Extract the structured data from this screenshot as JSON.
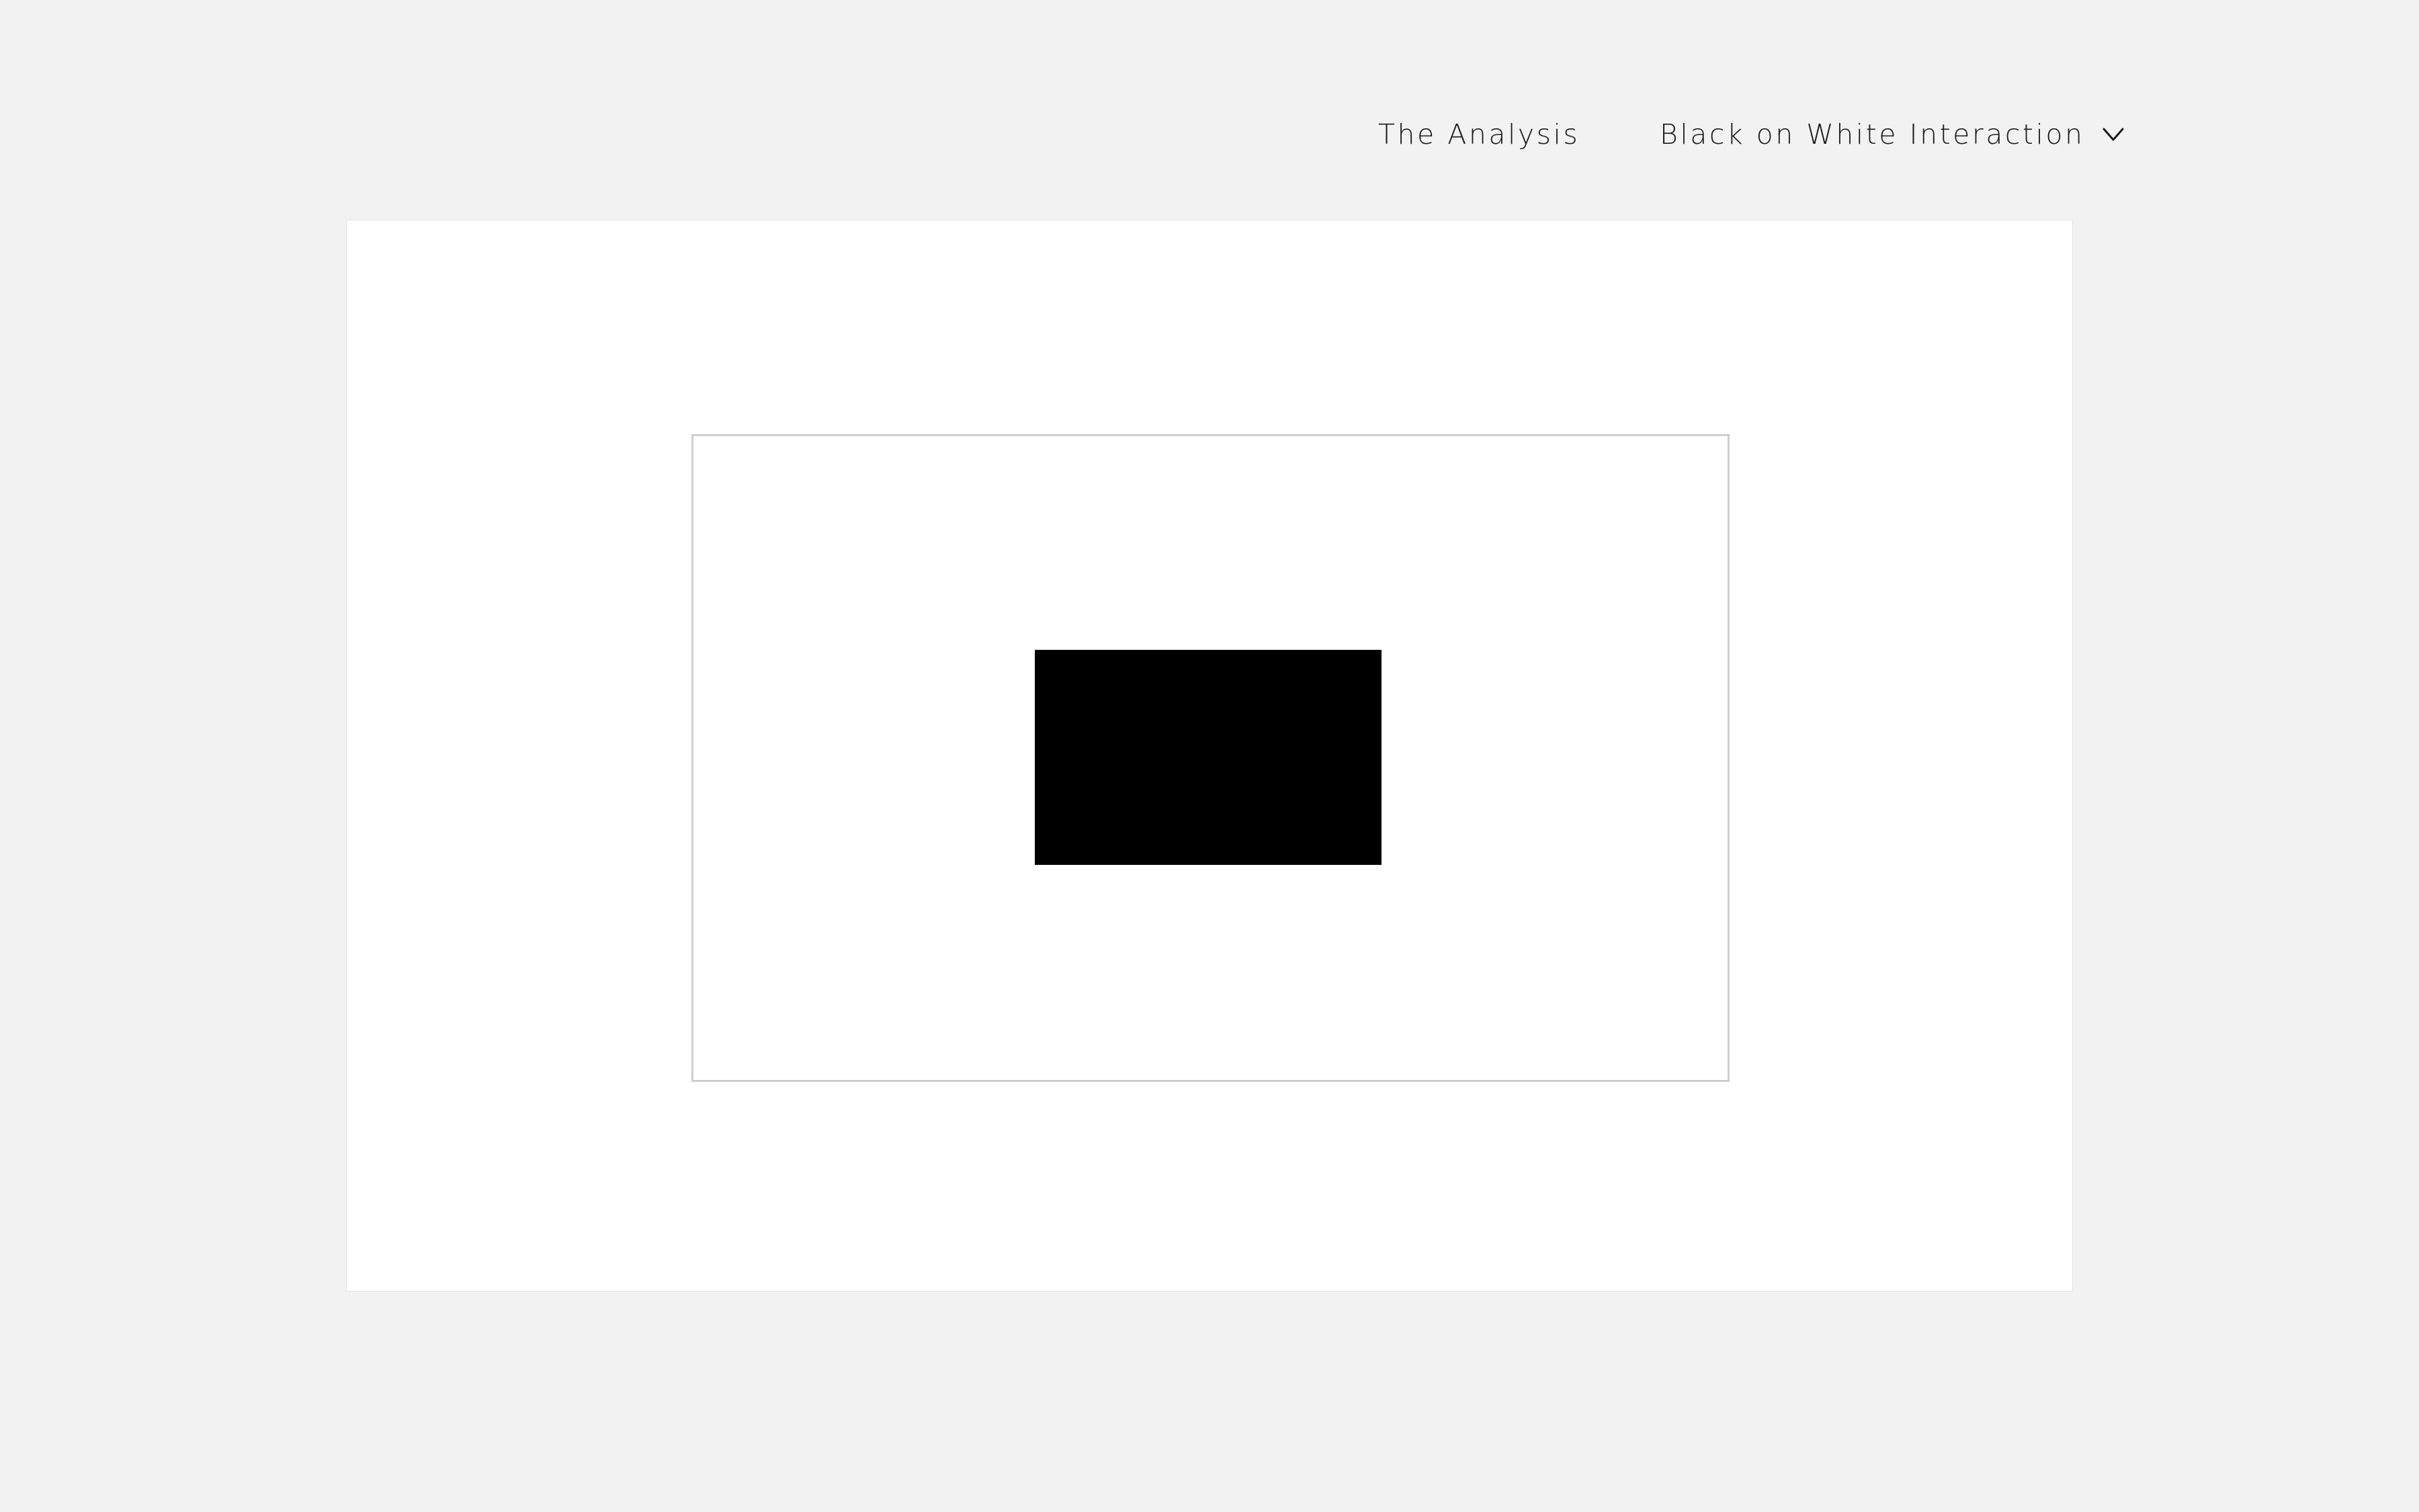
{
  "nav": {
    "analysis_label": "The Analysis",
    "mode_label": "Black on White Interaction",
    "mode_icon": "chevron-down-icon"
  },
  "colors": {
    "background": "#f2f2f2",
    "card": "#ffffff",
    "frame_border": "#cfcfcf",
    "figure": "#000000",
    "text": "#1a1a1a"
  }
}
